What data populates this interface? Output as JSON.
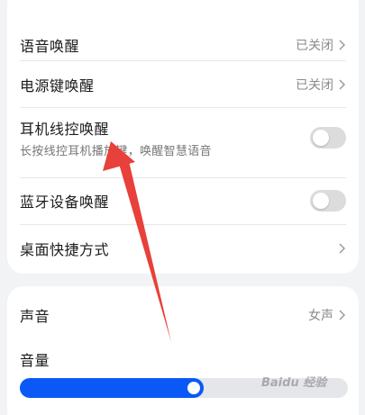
{
  "wake_settings": {
    "voice_wake": {
      "label": "语音唤醒",
      "value": "已关闭"
    },
    "power_key_wake": {
      "label": "电源键唤醒",
      "value": "已关闭"
    },
    "headset_wake": {
      "label": "耳机线控唤醒",
      "description": "长按线控耳机播放键，唤醒智慧语音",
      "enabled": false
    },
    "bluetooth_wake": {
      "label": "蓝牙设备唤醒",
      "enabled": false
    },
    "desktop_shortcut": {
      "label": "桌面快捷方式"
    }
  },
  "voice_settings": {
    "voice": {
      "label": "声音",
      "value": "女声"
    },
    "volume": {
      "label": "音量",
      "level_percent": 56
    }
  },
  "colors": {
    "accent": "#0a59f7",
    "annotation_arrow": "#e8403a"
  },
  "watermark": "Baidu 经验"
}
